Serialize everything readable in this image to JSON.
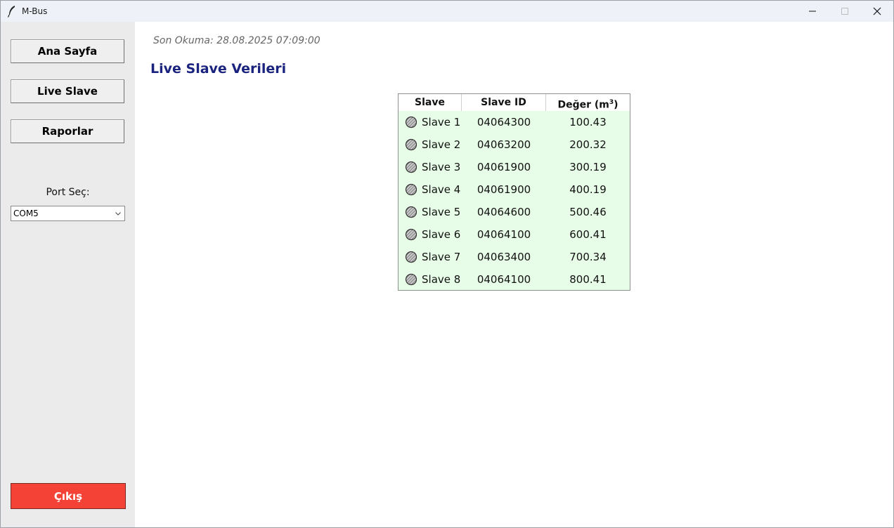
{
  "window": {
    "title": "M-Bus"
  },
  "sidebar": {
    "buttons": [
      {
        "label": "Ana Sayfa"
      },
      {
        "label": "Live Slave"
      },
      {
        "label": "Raporlar"
      }
    ],
    "port_label": "Port Seç:",
    "port_value": "COM5",
    "exit_label": "Çıkış"
  },
  "main": {
    "last_read": "Son Okuma: 28.08.2025 07:09:00",
    "title": "Live Slave Verileri",
    "table": {
      "headers": [
        "Slave",
        "Slave ID",
        "Değer (m",
        "3",
        ")"
      ],
      "rows": [
        {
          "name": "Slave 1",
          "id": "04064300",
          "value": "100.43"
        },
        {
          "name": "Slave 2",
          "id": "04063200",
          "value": "200.32"
        },
        {
          "name": "Slave 3",
          "id": "04061900",
          "value": "300.19"
        },
        {
          "name": "Slave 4",
          "id": "04061900",
          "value": "400.19"
        },
        {
          "name": "Slave 5",
          "id": "04064600",
          "value": "500.46"
        },
        {
          "name": "Slave 6",
          "id": "04064100",
          "value": "600.41"
        },
        {
          "name": "Slave 7",
          "id": "04063400",
          "value": "700.34"
        },
        {
          "name": "Slave 8",
          "id": "04064100",
          "value": "800.41"
        }
      ]
    }
  },
  "icons": {
    "app": "feather-icon",
    "status": "status-dot-icon",
    "minimize": "minimize-icon",
    "maximize": "maximize-icon",
    "close": "close-icon",
    "dropdown": "chevron-down-icon"
  }
}
